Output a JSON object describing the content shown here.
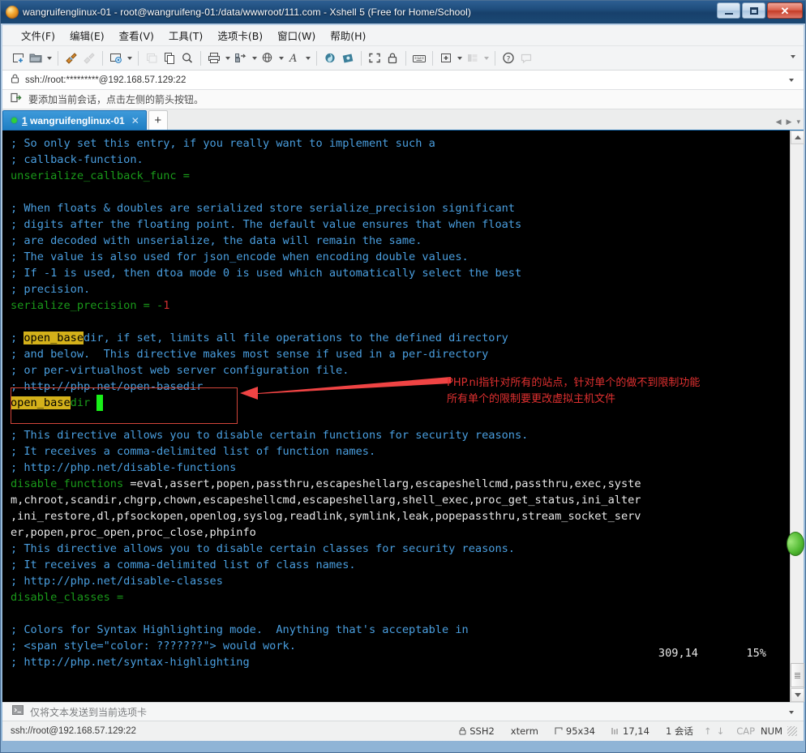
{
  "window": {
    "title": "wangruifenglinux-01 - root@wangruifeng-01:/data/wwwroot/111.com - Xshell 5 (Free for Home/School)",
    "app_icon": "xshell-icon",
    "minimize_label": "",
    "maximize_label": "",
    "close_label": "✕"
  },
  "menubar": {
    "items": [
      {
        "label": "文件(F)"
      },
      {
        "label": "编辑(E)"
      },
      {
        "label": "查看(V)"
      },
      {
        "label": "工具(T)"
      },
      {
        "label": "选项卡(B)"
      },
      {
        "label": "窗口(W)"
      },
      {
        "label": "帮助(H)"
      }
    ]
  },
  "toolbar": {
    "icons": [
      "new-session-icon",
      "open-folder-icon",
      "connect-icon",
      "disconnect-icon",
      "session-properties-icon",
      "copy-session-icon",
      "paste-icon",
      "find-icon",
      "print-icon",
      "transfer-icon",
      "web-transfer-icon",
      "font-icon",
      "xftp-icon",
      "xftp-alt-icon",
      "fullscreen-icon",
      "lock-icon",
      "keyboard-icon",
      "add-pane-icon",
      "layout-icon",
      "help-icon",
      "comment-icon"
    ],
    "overflow_label": "▾"
  },
  "address_bar": {
    "icon": "lock-icon",
    "value": "ssh://root:*********@192.168.57.129:22",
    "placeholder": "ssh://host:port",
    "dropdown_label": "▾"
  },
  "notice_bar": {
    "icon": "add-session-icon",
    "text": "要添加当前会话，点击左侧的箭头按钮。"
  },
  "tabs": {
    "items": [
      {
        "index": "1",
        "label": "wangruifenglinux-01",
        "status": "connected",
        "close_label": "✕"
      }
    ],
    "new_tab_label": "+",
    "nav_prev_label": "◀",
    "nav_next_label": "▶",
    "nav_menu_label": "▾"
  },
  "terminal": {
    "title": "php.ini editor buffer",
    "lines": [
      {
        "segments": [
          {
            "text": "; So only set this entry, if you really want to implement such a",
            "cls": "c-comment"
          }
        ]
      },
      {
        "segments": [
          {
            "text": "; callback-function.",
            "cls": "c-comment"
          }
        ]
      },
      {
        "segments": [
          {
            "text": "unserialize_callback_func =",
            "cls": "c-key"
          }
        ]
      },
      {
        "segments": [
          {
            "text": "",
            "cls": "c-val"
          }
        ]
      },
      {
        "segments": [
          {
            "text": "; When floats & doubles are serialized store serialize_precision significant",
            "cls": "c-comment"
          }
        ]
      },
      {
        "segments": [
          {
            "text": "; digits after the floating point. The default value ensures that when floats",
            "cls": "c-comment"
          }
        ]
      },
      {
        "segments": [
          {
            "text": "; are decoded with unserialize, the data will remain the same.",
            "cls": "c-comment"
          }
        ]
      },
      {
        "segments": [
          {
            "text": "; The value is also used for json_encode when encoding double values.",
            "cls": "c-comment"
          }
        ]
      },
      {
        "segments": [
          {
            "text": "; If -1 is used, then dtoa mode 0 is used which automatically select the best",
            "cls": "c-comment"
          }
        ]
      },
      {
        "segments": [
          {
            "text": "; precision.",
            "cls": "c-comment"
          }
        ]
      },
      {
        "segments": [
          {
            "text": "serialize_precision = -",
            "cls": "c-key"
          },
          {
            "text": "1",
            "cls": "c-num"
          }
        ]
      },
      {
        "segments": [
          {
            "text": "",
            "cls": "c-val"
          }
        ]
      },
      {
        "segments": [
          {
            "text": "; ",
            "cls": "c-comment"
          },
          {
            "text": "open_base",
            "cls": "c-hl"
          },
          {
            "text": "dir, if set, limits all file operations to the defined directory",
            "cls": "c-comment"
          }
        ]
      },
      {
        "segments": [
          {
            "text": "; and below.  This directive makes most sense if used in a per-directory",
            "cls": "c-comment"
          }
        ]
      },
      {
        "segments": [
          {
            "text": "; or per-virtualhost web server configuration file.",
            "cls": "c-comment"
          }
        ]
      },
      {
        "segments": [
          {
            "text": "; http://php.net/open-basedir",
            "cls": "c-comment"
          }
        ]
      },
      {
        "segments": [
          {
            "text": "open_base",
            "cls": "c-hl"
          },
          {
            "text": "dir ",
            "cls": "c-key"
          },
          {
            "text": "=",
            "cls": "cursor"
          }
        ]
      },
      {
        "segments": [
          {
            "text": "",
            "cls": "c-val"
          }
        ]
      },
      {
        "segments": [
          {
            "text": "; This directive allows you to disable certain functions for security reasons.",
            "cls": "c-comment"
          }
        ]
      },
      {
        "segments": [
          {
            "text": "; It receives a comma-delimited list of function names.",
            "cls": "c-comment"
          }
        ]
      },
      {
        "segments": [
          {
            "text": "; http://php.net/disable-functions",
            "cls": "c-comment"
          }
        ]
      },
      {
        "segments": [
          {
            "text": "disable_functions ",
            "cls": "c-key"
          },
          {
            "text": "=eval,assert,popen,passthru,escapeshellarg,escapeshellcmd,passthru,exec,syste",
            "cls": "c-val"
          }
        ]
      },
      {
        "segments": [
          {
            "text": "m,chroot,scandir,chgrp,chown,escapeshellcmd,escapeshellarg,shell_exec,proc_get_status,ini_alter",
            "cls": "c-val"
          }
        ]
      },
      {
        "segments": [
          {
            "text": ",ini_restore,dl,pfsockopen,openlog,syslog,readlink,symlink,leak,popepassthru,stream_socket_serv",
            "cls": "c-val"
          }
        ]
      },
      {
        "segments": [
          {
            "text": "er,popen,proc_open,proc_close,phpinfo",
            "cls": "c-val"
          }
        ]
      },
      {
        "segments": [
          {
            "text": "; This directive allows you to disable certain classes for security reasons.",
            "cls": "c-comment"
          }
        ]
      },
      {
        "segments": [
          {
            "text": "; It receives a comma-delimited list of class names.",
            "cls": "c-comment"
          }
        ]
      },
      {
        "segments": [
          {
            "text": "; http://php.net/disable-classes",
            "cls": "c-comment"
          }
        ]
      },
      {
        "segments": [
          {
            "text": "disable_classes =",
            "cls": "c-key"
          }
        ]
      },
      {
        "segments": [
          {
            "text": "",
            "cls": "c-val"
          }
        ]
      },
      {
        "segments": [
          {
            "text": "; Colors for Syntax Highlighting mode.  Anything that's acceptable in",
            "cls": "c-comment"
          }
        ]
      },
      {
        "segments": [
          {
            "text": "; <span style=\"color: ???????\"> would work.",
            "cls": "c-comment"
          }
        ]
      },
      {
        "segments": [
          {
            "text": "; http://php.net/syntax-highlighting",
            "cls": "c-comment"
          }
        ]
      }
    ],
    "cursor_position": "309,14",
    "zoom_percent": "15%",
    "colors": {
      "background": "#000000",
      "comment": "#4a9fe0",
      "key": "#1a9a1a",
      "value": "#e8e8e8",
      "number": "#d03030",
      "highlight_bg": "#d4b11a",
      "cursor": "#18f018"
    }
  },
  "annotation": {
    "line1": "PHP.ni指针对所有的站点，针对单个的做不到限制功能",
    "line2": "所有单个的限制要更改虚拟主机文件",
    "color": "#e03030",
    "box_color": "#d2453a"
  },
  "send_bar": {
    "icon": "terminal-icon",
    "text": "仅将文本发送到当前选项卡",
    "dropdown_label": "▾"
  },
  "status_bar": {
    "connection": "ssh://root@192.168.57.129:22",
    "protocol": "SSH2",
    "terminal_type": "xterm",
    "size": "95x34",
    "position": "17,14",
    "sessions": "1 会话",
    "caps_lock": "CAP",
    "num_lock": "NUM",
    "up_arrow": "↑",
    "down_arrow": "↓"
  }
}
